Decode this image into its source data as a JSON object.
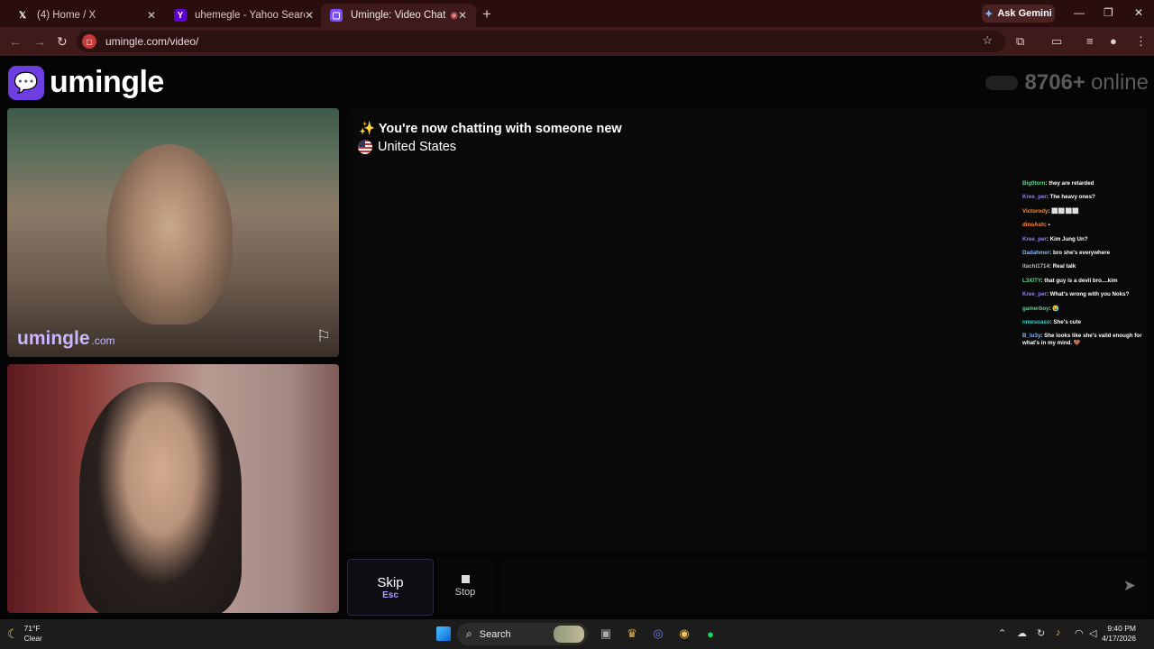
{
  "browser": {
    "tabs": [
      {
        "title": "(4) Home / X",
        "icon": "x-logo-icon"
      },
      {
        "title": "uhemegle - Yahoo Search Results",
        "icon": "yahoo-icon"
      },
      {
        "title": "Umingle: Video Chat with Strangers",
        "icon": "umingle-icon",
        "active": true
      }
    ],
    "new_tab": "+",
    "ask_gemini": "Ask Gemini",
    "url": "umingle.com/video/"
  },
  "site": {
    "logo_text": "umingle",
    "online_count": "8706+",
    "online_label": "online",
    "watermark": "umingle",
    "watermark_suffix": ".com"
  },
  "chat": {
    "status_line": "✨ You're now chatting with someone new",
    "country": "United States"
  },
  "stream_chat": [
    {
      "user": "Big0torn",
      "text": "they are retarded",
      "color": "#5fd38a"
    },
    {
      "user": "Kree_per",
      "text": "The heavy ones?",
      "color": "#9b7bff"
    },
    {
      "user": "Victorody",
      "text": "⬜⬜⬜⬜",
      "color": "#ff8a3d"
    },
    {
      "user": "dinoAsh",
      "text": "▪",
      "color": "#ff8a3d"
    },
    {
      "user": "Kree_per",
      "text": "Kim Jung Un?",
      "color": "#9b7bff"
    },
    {
      "user": "Dadahmer",
      "text": "bro she's everywhere",
      "color": "#7fb7ff"
    },
    {
      "user": "itachi1714",
      "text": "Real talk",
      "color": "#bbbbbb"
    },
    {
      "user": "L3XITY",
      "text": "that guy is a devil bro....kim",
      "color": "#5fd38a"
    },
    {
      "user": "Kree_per",
      "text": "What's wrong with you Noks?",
      "color": "#9b7bff"
    },
    {
      "user": "gamerboy",
      "text": "😭",
      "color": "#5fd38a"
    },
    {
      "user": "nmesoaso",
      "text": "She's cute",
      "color": "#3ed0c8"
    },
    {
      "user": "B_lu3y",
      "text": "She looks like she's valid enough for what's in my mind. 🤎",
      "color": "#7fb7ff"
    }
  ],
  "controls": {
    "skip_label": "Skip",
    "skip_key": "Esc",
    "stop_label": "Stop"
  },
  "taskbar": {
    "temperature": "71°F",
    "condition": "Clear",
    "search_label": "Search",
    "time": "9:40 PM",
    "date": "4/17/2026"
  }
}
